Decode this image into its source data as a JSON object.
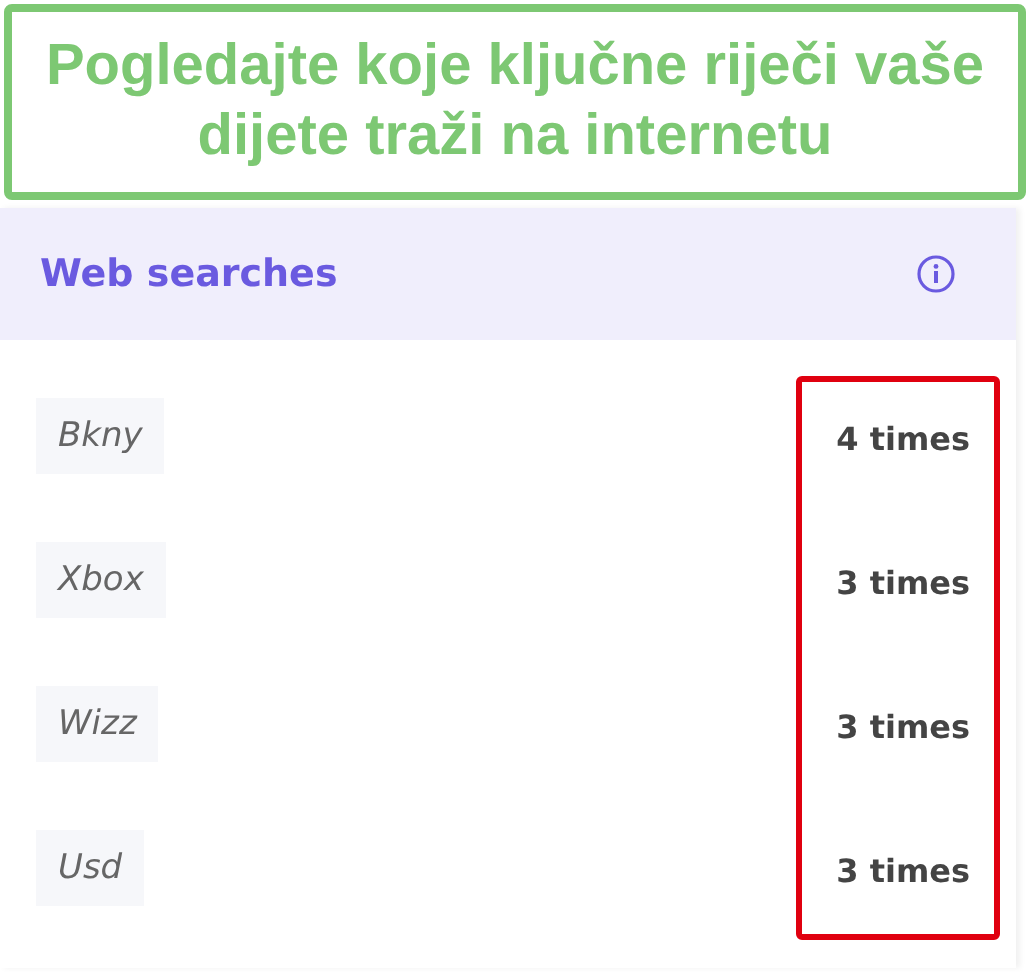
{
  "banner": {
    "text": "Pogledajte koje ključne riječi vaše dijete traži na internetu"
  },
  "panel": {
    "title": "Web searches"
  },
  "searches": [
    {
      "term": "Bkny",
      "count": "4 times"
    },
    {
      "term": "Xbox",
      "count": "3 times"
    },
    {
      "term": "Wizz",
      "count": "3 times"
    },
    {
      "term": "Usd",
      "count": "3 times"
    }
  ]
}
